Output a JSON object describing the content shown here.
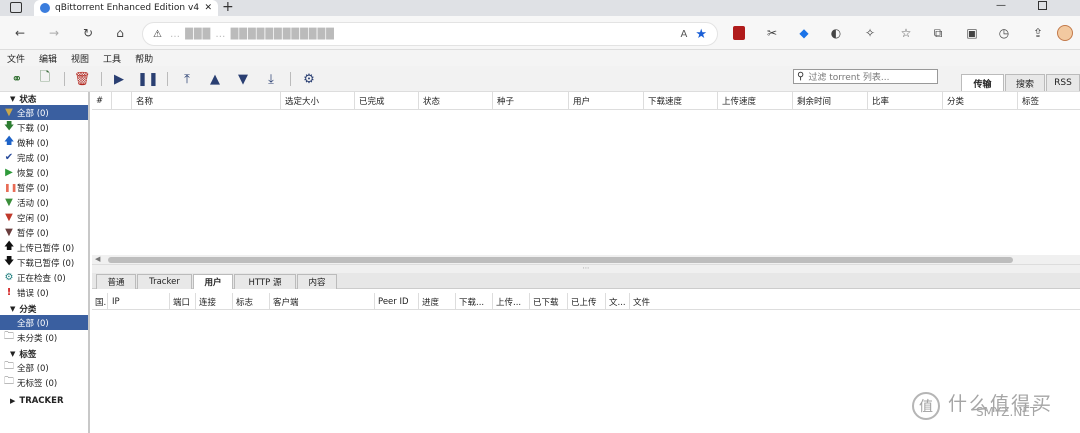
{
  "browser": {
    "tab_title": "qBittorrent Enhanced Edition v4.",
    "new_tab": "+",
    "url_text": "… ███ …  ████████████"
  },
  "menu": [
    "文件",
    "编辑",
    "视图",
    "工具",
    "帮助"
  ],
  "search": {
    "placeholder": "过滤 torrent 列表..."
  },
  "right_tabs": [
    "传输",
    "搜索",
    "RSS"
  ],
  "sidebar": {
    "status_header": "状态",
    "status_items": [
      {
        "label": "全部 (0)",
        "icon": "filter-icon",
        "color": "#c8a64b"
      },
      {
        "label": "下载 (0)",
        "icon": "arrow-down-icon",
        "color": "#2e7d32"
      },
      {
        "label": "做种 (0)",
        "icon": "arrow-up-icon",
        "color": "#1e63c8"
      },
      {
        "label": "完成 (0)",
        "icon": "check-icon",
        "color": "#2a4d9c"
      },
      {
        "label": "恢复 (0)",
        "icon": "play-icon",
        "color": "#2e9a3a"
      },
      {
        "label": "暂停 (0)",
        "icon": "pause-icon",
        "color": "#e86b55"
      },
      {
        "label": "活动 (0)",
        "icon": "filter-icon",
        "color": "#3b8e3b"
      },
      {
        "label": "空闲 (0)",
        "icon": "filter-icon",
        "color": "#c0392b"
      },
      {
        "label": "暂停 (0)",
        "icon": "filter-icon",
        "color": "#6a3d3d"
      },
      {
        "label": "上传已暂停 (0)",
        "icon": "arrow-up-icon",
        "color": "#111"
      },
      {
        "label": "下载已暂停 (0)",
        "icon": "arrow-down-icon",
        "color": "#111"
      },
      {
        "label": "正在检查 (0)",
        "icon": "gear-icon",
        "color": "#1f7f7f"
      },
      {
        "label": "错误 (0)",
        "icon": "error-icon",
        "color": "#d32020"
      }
    ],
    "category_header": "分类",
    "category_items": [
      "全部 (0)",
      "未分类 (0)"
    ],
    "tag_header": "标签",
    "tag_items": [
      "全部 (0)",
      "无标签 (0)"
    ],
    "tracker_header": "TRACKER"
  },
  "torrent_columns": [
    "#",
    "名称",
    "选定大小",
    "已完成",
    "状态",
    "种子",
    "用户",
    "下载速度",
    "上传速度",
    "剩余时间",
    "比率",
    "分类",
    "标签"
  ],
  "panel_tabs": [
    "普通",
    "Tracker",
    "用户",
    "HTTP 源",
    "内容"
  ],
  "peer_columns": [
    "国.",
    "IP",
    "端口",
    "连接",
    "标志",
    "客户端",
    "Peer ID",
    "进度",
    "下载...",
    "上传...",
    "已下载",
    "已上传",
    "文...",
    "文件"
  ],
  "watermark": {
    "text": "什么值得买",
    "sub": "SMYZ.NET",
    "glyph": "值"
  }
}
